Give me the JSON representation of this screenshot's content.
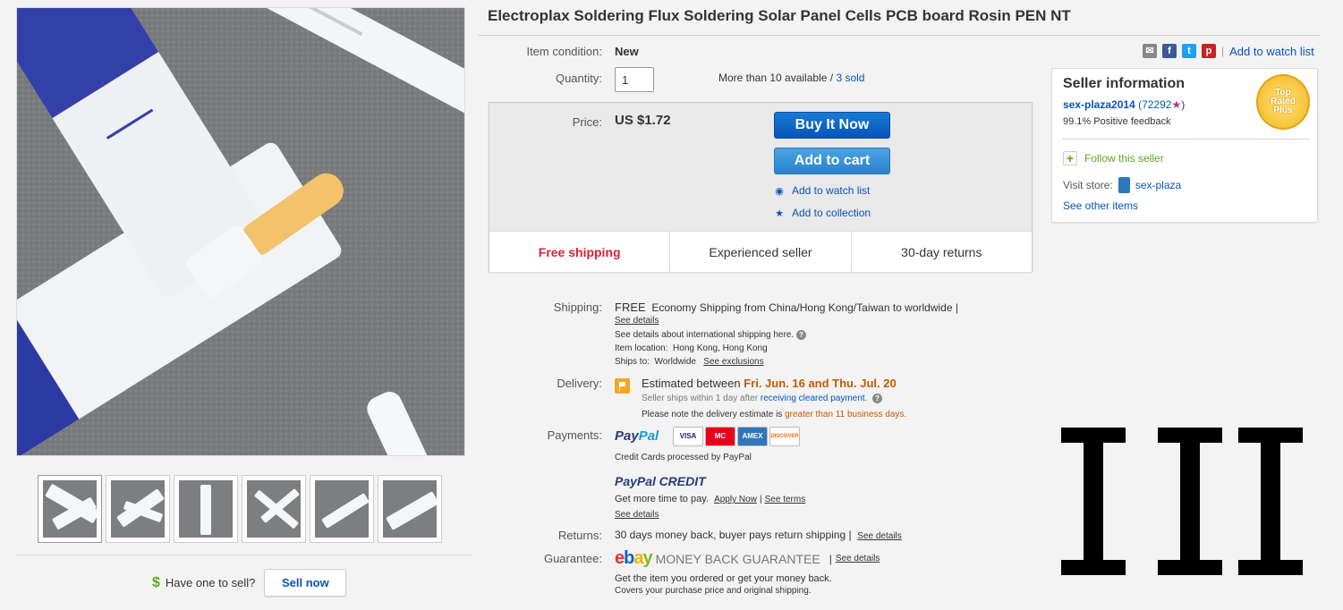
{
  "title": "Electroplax Soldering Flux Soldering Solar Panel Cells PCB board Rosin PEN NT",
  "condition": {
    "label": "Item condition:",
    "value": "New"
  },
  "quantity": {
    "label": "Quantity:",
    "value": "1",
    "available": "More than 10 available",
    "separator": " / ",
    "sold": "3 sold"
  },
  "price": {
    "label": "Price:",
    "value": "US $1.72"
  },
  "actions": {
    "buy_now": "Buy It Now",
    "add_to_cart": "Add to cart",
    "watch": "Add to watch list",
    "collection": "Add to collection"
  },
  "perks": [
    "Free shipping",
    "Experienced seller",
    "30-day returns"
  ],
  "shipping": {
    "label": "Shipping:",
    "free": "FREE",
    "service": "Economy Shipping from China/Hong Kong/Taiwan to worldwide |",
    "details": "See details",
    "intl_note": "See details about international shipping here.",
    "location_label": "Item location:",
    "location": "Hong Kong, Hong Kong",
    "ships_to_label": "Ships to:",
    "ships_to": "Worldwide",
    "exclusions": "See exclusions"
  },
  "delivery": {
    "label": "Delivery:",
    "estimated": "Estimated between",
    "dates": "Fri. Jun. 16 and Thu. Jul. 20",
    "handling": "Seller ships within 1 day after",
    "handling_link": "receiving cleared payment",
    "handling_end": ".",
    "note": "Please note the delivery estimate is",
    "note_emph": "greater than 11 business days."
  },
  "payments": {
    "label": "Payments:",
    "paypal_1": "Pay",
    "paypal_2": "Pal",
    "cards": [
      "VISA",
      "MC",
      "AMEX",
      "DISCOVER"
    ],
    "processed": "Credit Cards processed by PayPal",
    "credit_1": "PayPal",
    "credit_2": "CREDIT",
    "more_time": "Get more time to pay.",
    "apply": "Apply Now",
    "sep": "|",
    "terms": "See terms",
    "details": "See details"
  },
  "returns": {
    "label": "Returns:",
    "text": "30 days money back, buyer pays return shipping |",
    "details": "See details"
  },
  "guarantee": {
    "label": "Guarantee:",
    "ebay": [
      "e",
      "b",
      "a",
      "y"
    ],
    "mbg": "MONEY BACK GUARANTEE",
    "sep": "|",
    "details": "See details",
    "line1": "Get the item you ordered or get your money back.",
    "line2": "Covers your purchase price and original shipping."
  },
  "social": {
    "sep": "|",
    "watch": "Add to watch list"
  },
  "seller": {
    "heading": "Seller information",
    "name": "sex-plaza2014",
    "score": "(72292",
    "score_end": ")",
    "feedback": "99.1% Positive feedback",
    "badge": [
      "Top",
      "Rated",
      "Plus"
    ],
    "follow": "Follow this seller",
    "visit_label": "Visit store:",
    "store": "sex-plaza",
    "other_items": "See other items"
  },
  "sell": {
    "prompt": "Have one to sell?",
    "button": "Sell now",
    "dollar": "$"
  },
  "colors": {
    "link": "#0654ba",
    "buy": "#0654ba",
    "red": "#dd1e31",
    "orange": "#c45a00"
  }
}
